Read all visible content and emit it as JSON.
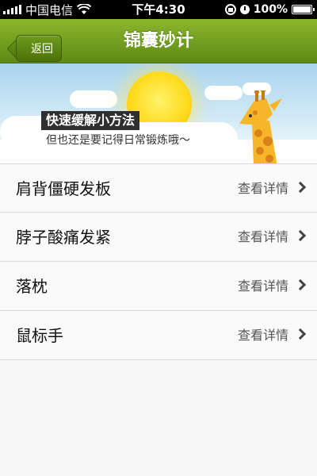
{
  "status_bar": {
    "carrier": "中国电信",
    "time": "下午4:30",
    "battery": "100%",
    "battery_level": 1.0
  },
  "nav": {
    "back_label": "返回",
    "title": "锦囊妙计"
  },
  "banner": {
    "tag": "快速缓解小方法",
    "subtitle": "但也还是要记得日常锻炼哦～"
  },
  "list": {
    "items": [
      {
        "title": "肩背僵硬发板",
        "detail": "查看详情"
      },
      {
        "title": "脖子酸痛发紧",
        "detail": "查看详情"
      },
      {
        "title": "落枕",
        "detail": "查看详情"
      },
      {
        "title": "鼠标手",
        "detail": "查看详情"
      }
    ]
  },
  "colors": {
    "nav_green": "#6f9e1f",
    "sun_yellow": "#ffd91a",
    "giraffe_orange": "#f0a41e"
  }
}
